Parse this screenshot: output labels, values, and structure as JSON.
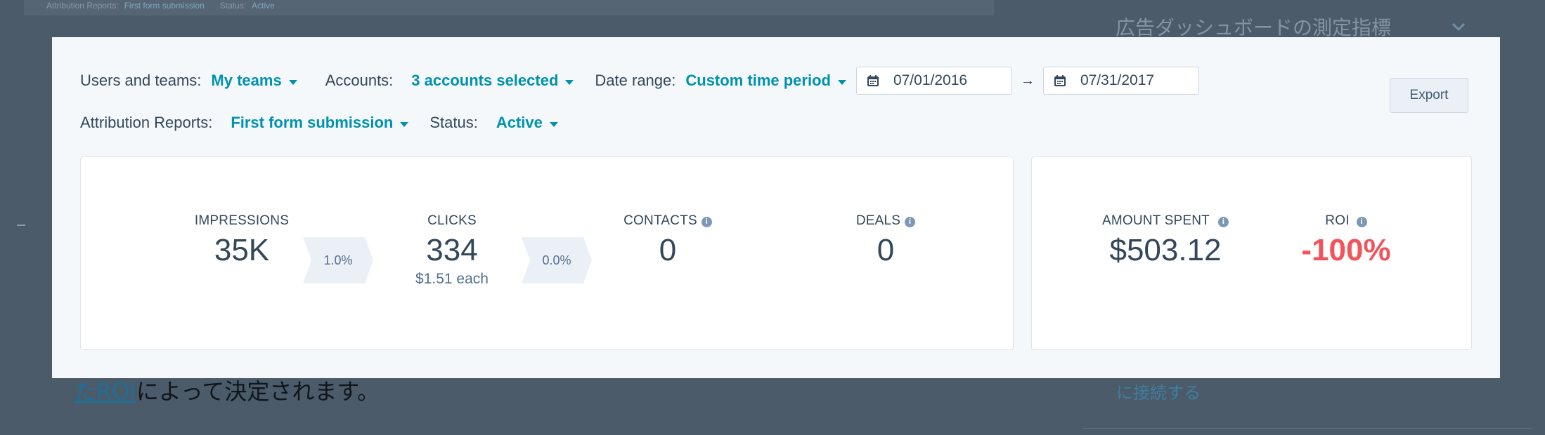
{
  "background": {
    "filter_strip": {
      "users_label": "Attribution Reports:",
      "report_value": "First form submission",
      "status_label": "Status:",
      "status_value": "Active"
    },
    "side_title": "広告ダッシュボードの測定指標",
    "body_link": "たROI",
    "body_text": "によって決定されます。",
    "side_link": "に接続する"
  },
  "filters": {
    "users_label": "Users and teams:",
    "users_value": "My teams",
    "accounts_label": "Accounts:",
    "accounts_value": "3 accounts selected",
    "date_range_label": "Date range:",
    "date_range_value": "Custom time period",
    "start_date": "07/01/2016",
    "arrow": "→",
    "end_date": "07/31/2017",
    "attribution_label": "Attribution Reports:",
    "attribution_value": "First form submission",
    "status_label": "Status:",
    "status_value": "Active"
  },
  "export_label": "Export",
  "funnel": {
    "impressions": {
      "label": "IMPRESSIONS",
      "value": "35K"
    },
    "rate1": "1.0%",
    "clicks": {
      "label": "CLICKS",
      "value": "334",
      "sub": "$1.51 each"
    },
    "rate2": "0.0%",
    "contacts": {
      "label": "CONTACTS",
      "value": "0"
    },
    "deals": {
      "label": "DEALS",
      "value": "0"
    }
  },
  "spend": {
    "amount": {
      "label": "AMOUNT SPENT",
      "value": "$503.12"
    },
    "roi": {
      "label": "ROI",
      "value": "-100%"
    }
  },
  "colors": {
    "accent": "#0091ae",
    "negative": "#f2545b",
    "overlay": "#4b5b6a"
  },
  "icons": {
    "calendar": "calendar-icon",
    "info": "info-icon",
    "caret": "caret-down-icon"
  }
}
